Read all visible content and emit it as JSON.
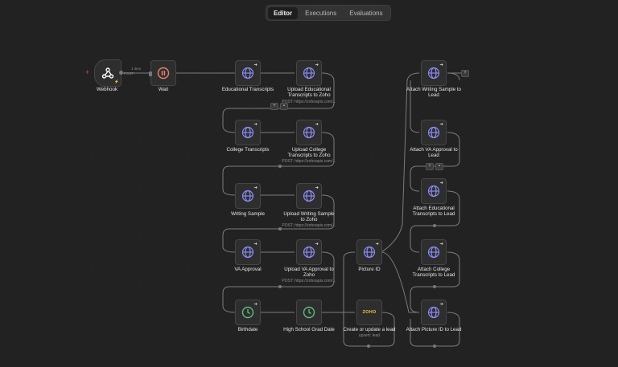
{
  "tabs": [
    {
      "label": "Editor",
      "active": true
    },
    {
      "label": "Executions",
      "active": false
    },
    {
      "label": "Evaluations",
      "active": false
    }
  ],
  "edge_label": {
    "count": "1 item",
    "method": "POST"
  },
  "nodes": {
    "webhook": {
      "label": "Webhook",
      "icon": "webhook-icon"
    },
    "wait": {
      "label": "Wait",
      "icon": "pause-icon"
    },
    "educational_transcripts": {
      "label": "Educational Transcripts",
      "icon": "globe-icon"
    },
    "upload_educational": {
      "label": "Upload Educational Transcripts to Zoho",
      "sub": "POST: https://zohoapis.com/...",
      "icon": "globe-icon"
    },
    "college_transcripts": {
      "label": "College Transcripts",
      "icon": "globe-icon"
    },
    "upload_college": {
      "label": "Upload College Transcripts to Zoho",
      "sub": "POST: https://zohoapis.com/...",
      "icon": "globe-icon"
    },
    "writing_sample": {
      "label": "Writing Sample",
      "icon": "globe-icon"
    },
    "upload_writing": {
      "label": "Upload Writing Sample to Zoho",
      "sub": "POST: https://zohoapis.com/...",
      "icon": "globe-icon"
    },
    "va_approval": {
      "label": "VA Approval",
      "icon": "globe-icon"
    },
    "upload_va": {
      "label": "Upload VA Approval to Zoho",
      "sub": "POST: https://zohoapis.com/...",
      "icon": "globe-icon"
    },
    "birthdate": {
      "label": "Birthdate",
      "icon": "clock-icon"
    },
    "high_school": {
      "label": "High School Grad Date",
      "icon": "clock-icon"
    },
    "picture_id": {
      "label": "Picture ID",
      "icon": "globe-icon"
    },
    "create_lead": {
      "label": "Create or update a lead",
      "sub": "upsert: lead",
      "icon": "zoho-logo-icon",
      "logo_text": "ZOHO"
    },
    "attach_writing": {
      "label": "Attach Writing Sample to Lead",
      "icon": "globe-icon"
    },
    "attach_va": {
      "label": "Attach VA Approval to Lead",
      "icon": "globe-icon"
    },
    "attach_educational": {
      "label": "Attach Educational Transcripts to Lead",
      "icon": "globe-icon"
    },
    "attach_college": {
      "label": "Attach College Transcripts to Lead",
      "icon": "globe-icon"
    },
    "attach_picture": {
      "label": "Attach Picture ID to Lead",
      "icon": "globe-icon"
    }
  },
  "colors": {
    "accent_globe": "#8b8cf5",
    "wait": "#e5836a",
    "clock": "#5fba7d",
    "webhook_badge": "#9c8cff"
  }
}
